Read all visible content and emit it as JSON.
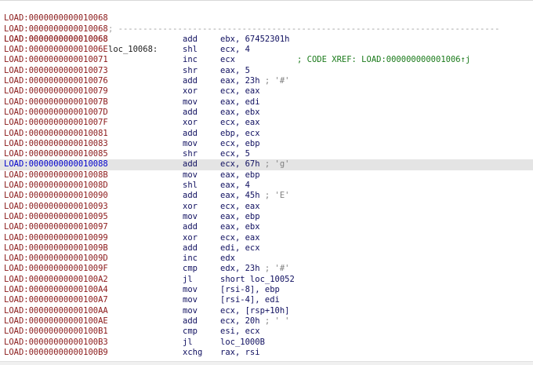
{
  "header_rows": [
    {
      "addr": "LOAD:0000000000010068",
      "dashes": "; -----------------------------------------------------------------------------"
    },
    {
      "addr": "LOAD:0000000000010068",
      "dashes": ""
    },
    {
      "addr": "LOAD:0000000000010068",
      "label": "loc_10068:",
      "xref": "; CODE XREF: LOAD:000000000001006↑j"
    }
  ],
  "rows": [
    {
      "addr": "LOAD:0000000000010068",
      "mn": "add",
      "op": "ebx, 67452301h",
      "cmt": ""
    },
    {
      "addr": "LOAD:000000000001006E",
      "mn": "shl",
      "op": "ecx, 4",
      "cmt": ""
    },
    {
      "addr": "LOAD:0000000000010071",
      "mn": "inc",
      "op": "ecx",
      "cmt": ""
    },
    {
      "addr": "LOAD:0000000000010073",
      "mn": "shr",
      "op": "eax, 5",
      "cmt": ""
    },
    {
      "addr": "LOAD:0000000000010076",
      "mn": "add",
      "op": "eax, 23h",
      "cmt": " ; '#'"
    },
    {
      "addr": "LOAD:0000000000010079",
      "mn": "xor",
      "op": "ecx, eax",
      "cmt": ""
    },
    {
      "addr": "LOAD:000000000001007B",
      "mn": "mov",
      "op": "eax, edi",
      "cmt": ""
    },
    {
      "addr": "LOAD:000000000001007D",
      "mn": "add",
      "op": "eax, ebx",
      "cmt": ""
    },
    {
      "addr": "LOAD:000000000001007F",
      "mn": "xor",
      "op": "ecx, eax",
      "cmt": ""
    },
    {
      "addr": "LOAD:0000000000010081",
      "mn": "add",
      "op": "ebp, ecx",
      "cmt": ""
    },
    {
      "addr": "LOAD:0000000000010083",
      "mn": "mov",
      "op": "ecx, ebp",
      "cmt": ""
    },
    {
      "addr": "LOAD:0000000000010085",
      "mn": "shr",
      "op": "ecx, 5",
      "cmt": ""
    },
    {
      "addr": "LOAD:0000000000010088",
      "mn": "add",
      "op": "ecx, 67h",
      "cmt": " ; 'g'",
      "selected": true
    },
    {
      "addr": "LOAD:000000000001008B",
      "mn": "mov",
      "op": "eax, ebp",
      "cmt": ""
    },
    {
      "addr": "LOAD:000000000001008D",
      "mn": "shl",
      "op": "eax, 4",
      "cmt": ""
    },
    {
      "addr": "LOAD:0000000000010090",
      "mn": "add",
      "op": "eax, 45h",
      "cmt": " ; 'E'"
    },
    {
      "addr": "LOAD:0000000000010093",
      "mn": "xor",
      "op": "ecx, eax",
      "cmt": ""
    },
    {
      "addr": "LOAD:0000000000010095",
      "mn": "mov",
      "op": "eax, ebp",
      "cmt": ""
    },
    {
      "addr": "LOAD:0000000000010097",
      "mn": "add",
      "op": "eax, ebx",
      "cmt": ""
    },
    {
      "addr": "LOAD:0000000000010099",
      "mn": "xor",
      "op": "ecx, eax",
      "cmt": ""
    },
    {
      "addr": "LOAD:000000000001009B",
      "mn": "add",
      "op": "edi, ecx",
      "cmt": ""
    },
    {
      "addr": "LOAD:000000000001009D",
      "mn": "inc",
      "op": "edx",
      "cmt": ""
    },
    {
      "addr": "LOAD:000000000001009F",
      "mn": "cmp",
      "op": "edx, 23h",
      "cmt": " ; '#'"
    },
    {
      "addr": "LOAD:00000000000100A2",
      "mn": "jl",
      "op": "short loc_10052",
      "cmt": ""
    },
    {
      "addr": "LOAD:00000000000100A4",
      "mn": "mov",
      "op": "[rsi-8], ebp",
      "cmt": ""
    },
    {
      "addr": "LOAD:00000000000100A7",
      "mn": "mov",
      "op": "[rsi-4], edi",
      "cmt": ""
    },
    {
      "addr": "LOAD:00000000000100AA",
      "mn": "mov",
      "op": "ecx, [rsp+10h]",
      "cmt": ""
    },
    {
      "addr": "LOAD:00000000000100AE",
      "mn": "add",
      "op": "ecx, 20h",
      "cmt": " ; ' '"
    },
    {
      "addr": "LOAD:00000000000100B1",
      "mn": "cmp",
      "op": "esi, ecx",
      "cmt": ""
    },
    {
      "addr": "LOAD:00000000000100B3",
      "mn": "jl",
      "op": "loc_1000B",
      "cmt": ""
    },
    {
      "addr": "LOAD:00000000000100B9",
      "mn": "xchg",
      "op": "rax, rsi",
      "cmt": ""
    }
  ],
  "colors": {
    "address": "#8b1a1a",
    "selected_address": "#0000cc",
    "selected_row_bg": "#e4e4e4",
    "xref_comment": "#1a7a1a",
    "comment": "#808080"
  }
}
